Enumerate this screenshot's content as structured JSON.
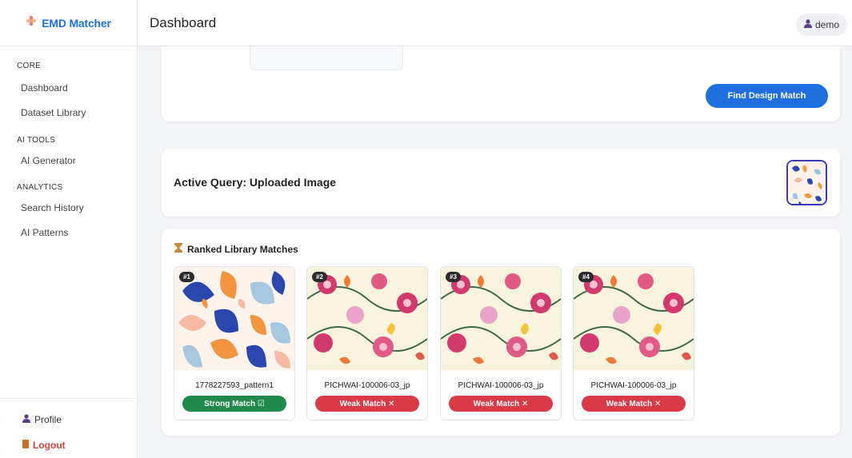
{
  "app": {
    "brand": "EMD Matcher"
  },
  "sidebar": {
    "sections": [
      {
        "label": "CORE",
        "items": [
          "Dashboard",
          "Dataset Library"
        ]
      },
      {
        "label": "AI TOOLS",
        "items": [
          "AI Generator"
        ]
      },
      {
        "label": "ANALYTICS",
        "items": [
          "Search History",
          "AI Patterns"
        ]
      }
    ],
    "profile": "Profile",
    "logout": "Logout"
  },
  "header": {
    "title": "Dashboard",
    "user": "demo"
  },
  "upload": {
    "button": "Find Design Match"
  },
  "query": {
    "title": "Active Query: Uploaded Image"
  },
  "results": {
    "title": "Ranked Library Matches",
    "items": [
      {
        "rank": "#1",
        "name": "1778227593_pattern1",
        "match": "Strong Match ☑",
        "status": "strong"
      },
      {
        "rank": "#2",
        "name": "PICHWAI-100006-03_jp",
        "match": "Weak Match ✕",
        "status": "weak"
      },
      {
        "rank": "#3",
        "name": "PICHWAI-100006-03_jp",
        "match": "Weak Match ✕",
        "status": "weak"
      },
      {
        "rank": "#4",
        "name": "PICHWAI-100006-03_jp",
        "match": "Weak Match ✕",
        "status": "weak"
      }
    ]
  },
  "colors": {
    "accent": "#1f6fe0",
    "strong": "#1f8a4c",
    "weak": "#d93a46",
    "logout": "#d64030"
  }
}
